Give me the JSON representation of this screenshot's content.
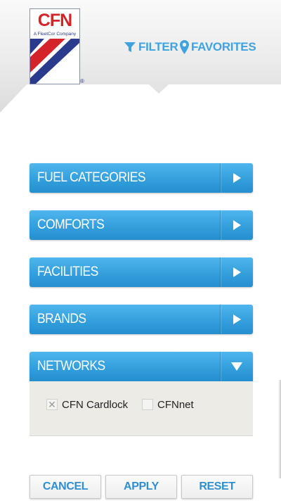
{
  "header": {
    "logo": {
      "brand": "CFN",
      "tagline": "A FleetCor Company",
      "registered": "®"
    },
    "nav": {
      "filter_label": "FILTER",
      "filter_icon": "filter-funnel-icon",
      "favorites_label": "FAVORITES",
      "favorites_icon": "map-pin-icon"
    },
    "accent_color": "#3ea3df"
  },
  "accordion": {
    "items": [
      {
        "label": "FUEL CATEGORIES",
        "expanded": false
      },
      {
        "label": "COMFORTS",
        "expanded": false
      },
      {
        "label": "FACILITIES",
        "expanded": false
      },
      {
        "label": "BRANDS",
        "expanded": false
      },
      {
        "label": "NETWORKS",
        "expanded": true
      }
    ],
    "bar_color": "#339fdc"
  },
  "networks": {
    "options": [
      {
        "label": "CFN Cardlock",
        "checked": true
      },
      {
        "label": "CFNnet",
        "checked": false
      }
    ]
  },
  "actions": {
    "cancel_label": "CANCEL",
    "apply_label": "APPLY",
    "reset_label": "RESET"
  }
}
